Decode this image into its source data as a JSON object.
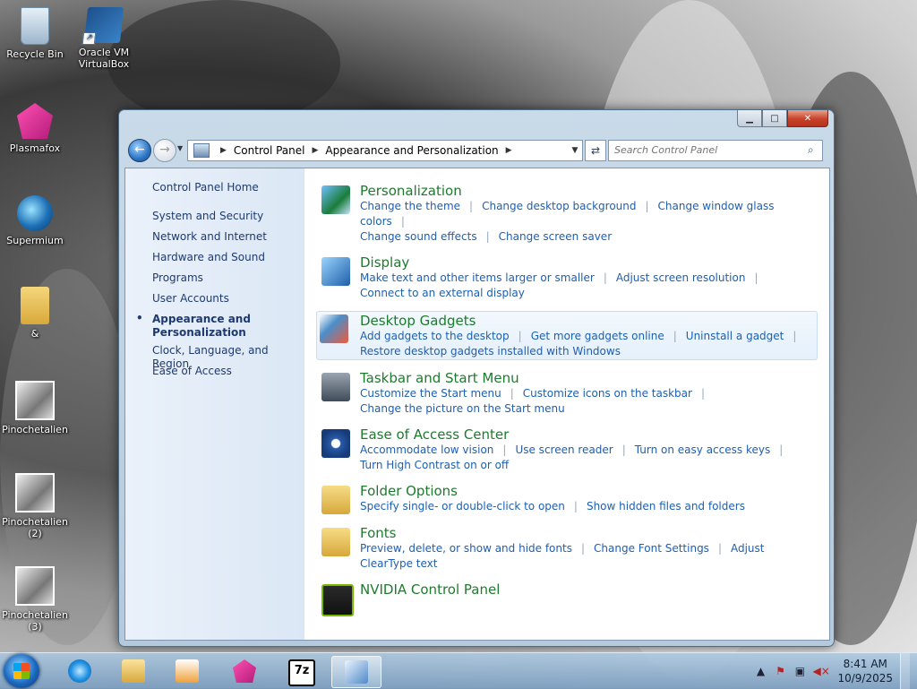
{
  "desktop": {
    "icons": [
      {
        "label": "Recycle Bin"
      },
      {
        "label": "Oracle VM VirtualBox"
      },
      {
        "label": "Plasmafox"
      },
      {
        "label": "Supermium"
      },
      {
        "label": "&"
      },
      {
        "label": "Pinochetalien"
      },
      {
        "label": "Pinochetalien (2)"
      },
      {
        "label": "Pinochetalien (3)"
      }
    ]
  },
  "window": {
    "breadcrumb": [
      "Control Panel",
      "Appearance and Personalization"
    ],
    "search_placeholder": "Search Control Panel",
    "left_pane": {
      "home": "Control Panel Home",
      "categories": [
        "System and Security",
        "Network and Internet",
        "Hardware and Sound",
        "Programs",
        "User Accounts",
        "Appearance and Personalization",
        "Clock, Language, and Region",
        "Ease of Access"
      ],
      "active_index": 5
    },
    "items": [
      {
        "title": "Personalization",
        "icon": "personalization-icon",
        "links": [
          "Change the theme",
          "Change desktop background",
          "Change window glass colors",
          "Change sound effects",
          "Change screen saver"
        ]
      },
      {
        "title": "Display",
        "icon": "display-icon",
        "links": [
          "Make text and other items larger or smaller",
          "Adjust screen resolution",
          "Connect to an external display"
        ]
      },
      {
        "title": "Desktop Gadgets",
        "icon": "gadgets-icon",
        "links": [
          "Add gadgets to the desktop",
          "Get more gadgets online",
          "Uninstall a gadget",
          "Restore desktop gadgets installed with Windows"
        ]
      },
      {
        "title": "Taskbar and Start Menu",
        "icon": "taskbar-icon",
        "links": [
          "Customize the Start menu",
          "Customize icons on the taskbar",
          "Change the picture on the Start menu"
        ]
      },
      {
        "title": "Ease of Access Center",
        "icon": "ease-of-access-icon",
        "links": [
          "Accommodate low vision",
          "Use screen reader",
          "Turn on easy access keys",
          "Turn High Contrast on or off"
        ]
      },
      {
        "title": "Folder Options",
        "icon": "folder-options-icon",
        "links": [
          "Specify single- or double-click to open",
          "Show hidden files and folders"
        ]
      },
      {
        "title": "Fonts",
        "icon": "fonts-icon",
        "links": [
          "Preview, delete, or show and hide fonts",
          "Change Font Settings",
          "Adjust ClearType text"
        ]
      },
      {
        "title": "NVIDIA Control Panel",
        "icon": "nvidia-icon",
        "links": []
      }
    ]
  },
  "taskbar": {
    "time": "8:41 AM",
    "date": "10/9/2025",
    "seven_zip_label": "7z"
  }
}
